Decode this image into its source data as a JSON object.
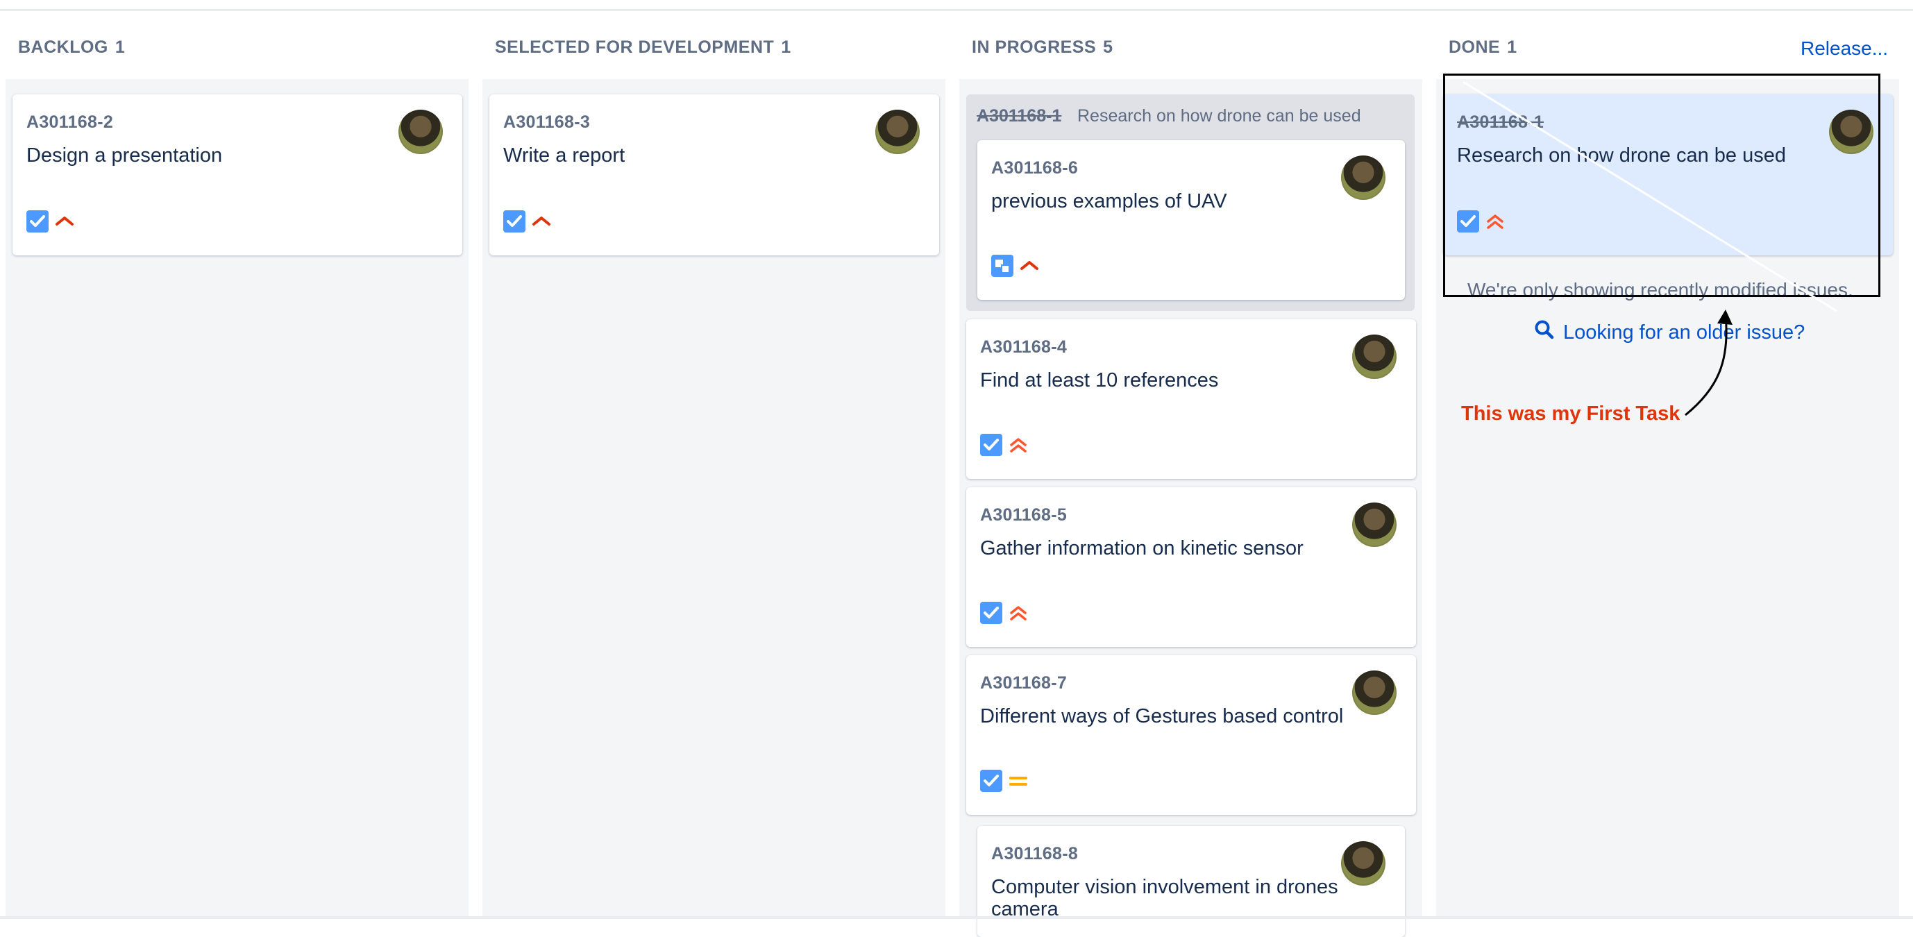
{
  "columns": [
    {
      "title": "BACKLOG",
      "count": "1"
    },
    {
      "title": "SELECTED FOR DEVELOPMENT",
      "count": "1"
    },
    {
      "title": "IN PROGRESS",
      "count": "5"
    },
    {
      "title": "DONE",
      "count": "1"
    }
  ],
  "release_label": "Release...",
  "backlog_cards": [
    {
      "key": "A301168-2",
      "summary": "Design a presentation",
      "type_icon": "task-checkbox-icon",
      "priority_icon": "priority-medium-icon"
    }
  ],
  "selected_cards": [
    {
      "key": "A301168-3",
      "summary": "Write a report",
      "type_icon": "task-checkbox-icon",
      "priority_icon": "priority-medium-icon"
    }
  ],
  "in_progress": {
    "parent": {
      "key": "A301168-1",
      "summary": "Research on how drone can be used"
    },
    "subtask_cards": [
      {
        "key": "A301168-6",
        "summary": "previous examples of UAV",
        "type_icon": "subtask-icon",
        "priority_icon": "priority-medium-icon"
      }
    ],
    "cards": [
      {
        "key": "A301168-4",
        "summary": "Find at least 10 references",
        "type_icon": "task-checkbox-icon",
        "priority_icon": "priority-high-icon"
      },
      {
        "key": "A301168-5",
        "summary": "Gather information on kinetic sensor",
        "type_icon": "task-checkbox-icon",
        "priority_icon": "priority-high-icon"
      },
      {
        "key": "A301168-7",
        "summary": "Different ways of Gestures based control",
        "type_icon": "task-checkbox-icon",
        "priority_icon": "priority-equal-icon"
      },
      {
        "key": "A301168-8",
        "summary": "Computer vision involvement in drones camera"
      }
    ]
  },
  "done_cards": [
    {
      "key": "A301168-1",
      "summary": "Research on how drone can be used",
      "type_icon": "task-checkbox-icon",
      "priority_icon": "priority-high-icon"
    }
  ],
  "done_note": "We're only showing recently modified issues.",
  "older_issue_link": "Looking for an older issue?",
  "annotation": {
    "text": "This was my First Task"
  },
  "colors": {
    "accent": "#0052cc",
    "priority_high": "#ff5630",
    "priority_medium": "#de350b",
    "priority_equal": "#ffab00",
    "task_icon": "#4c9aff",
    "annotation_text": "#de350b"
  }
}
